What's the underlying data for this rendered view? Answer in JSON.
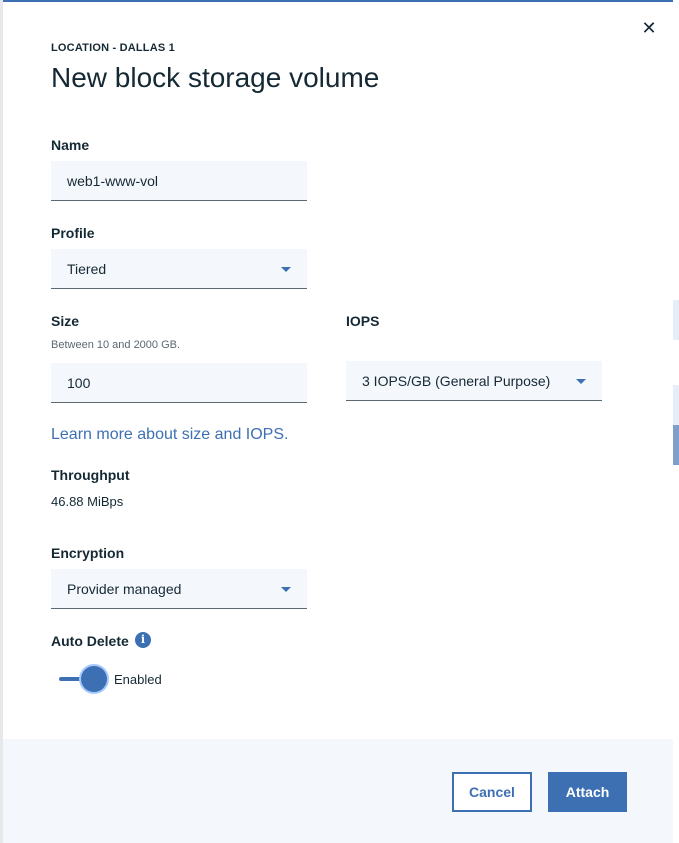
{
  "modal": {
    "eyebrow": "LOCATION - DALLAS 1",
    "title": "New block storage volume",
    "close_icon": "close-icon"
  },
  "form": {
    "name": {
      "label": "Name",
      "value": "web1-www-vol"
    },
    "profile": {
      "label": "Profile",
      "value": "Tiered"
    },
    "size": {
      "label": "Size",
      "helper": "Between 10 and 2000 GB.",
      "value": "100"
    },
    "iops": {
      "label": "IOPS",
      "value": "3 IOPS/GB (General Purpose)"
    },
    "learn_more": "Learn more about size and IOPS.",
    "throughput": {
      "label": "Throughput",
      "value": "46.88 MiBps"
    },
    "encryption": {
      "label": "Encryption",
      "value": "Provider managed"
    },
    "auto_delete": {
      "label": "Auto Delete",
      "info_icon": "info-icon",
      "state": "Enabled"
    }
  },
  "footer": {
    "cancel_label": "Cancel",
    "attach_label": "Attach"
  },
  "colors": {
    "accent": "#3d70b2",
    "text": "#152935",
    "field_bg": "#f4f7fb"
  }
}
